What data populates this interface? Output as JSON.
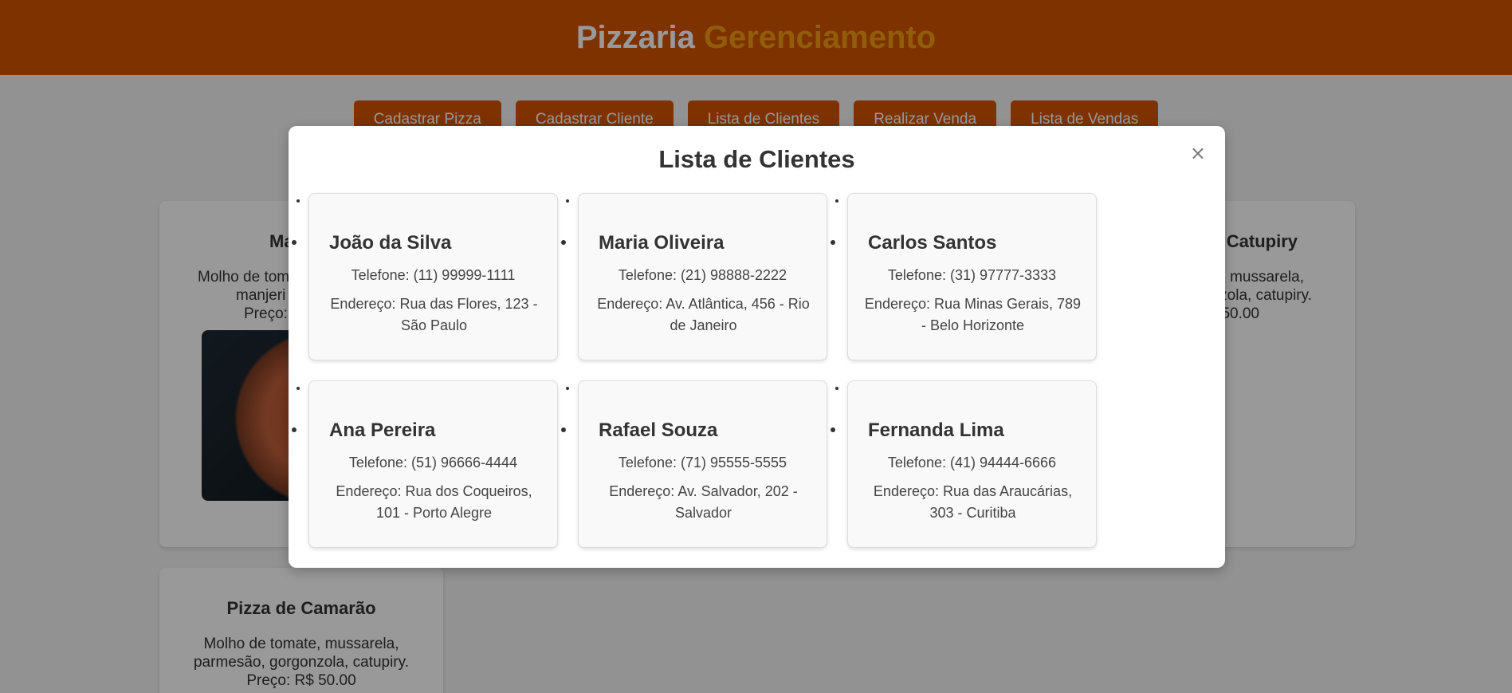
{
  "header": {
    "brand_main": "Pizzaria",
    "brand_accent": "Gerenciamento"
  },
  "nav": {
    "items": [
      {
        "label": "Cadastrar Pizza"
      },
      {
        "label": "Cadastrar Cliente"
      },
      {
        "label": "Lista de Clientes"
      },
      {
        "label": "Realizar Venda"
      },
      {
        "label": "Lista de Vendas"
      }
    ]
  },
  "pizzas": [
    {
      "name": "Mar",
      "desc_line1": "Molho de tom",
      "desc_line2": "manjeri",
      "price": "Preço:"
    },
    {
      "name": "Catupiry",
      "desc_line1": "e, mussarela,",
      "desc_line2": "nzola, catupiry.",
      "price": "50.00"
    },
    {
      "name": "Pizza de Camarão",
      "desc_line1": "Molho de tomate, mussarela,",
      "desc_line2": "parmesão, gorgonzola, catupiry.",
      "price": "Preço: R$ 50.00"
    }
  ],
  "modal": {
    "title": "Lista de Clientes",
    "close_label": "×",
    "clients": [
      {
        "name": "João da Silva",
        "phone": "Telefone: (11) 99999-1111",
        "address": "Endereço: Rua das Flores, 123 - São Paulo"
      },
      {
        "name": "Maria Oliveira",
        "phone": "Telefone: (21) 98888-2222",
        "address": "Endereço: Av. Atlântica, 456 - Rio de Janeiro"
      },
      {
        "name": "Carlos Santos",
        "phone": "Telefone: (31) 97777-3333",
        "address": "Endereço: Rua Minas Gerais, 789 - Belo Horizonte"
      },
      {
        "name": "Ana Pereira",
        "phone": "Telefone: (51) 96666-4444",
        "address": "Endereço: Rua dos Coqueiros, 101 - Porto Alegre"
      },
      {
        "name": "Rafael Souza",
        "phone": "Telefone: (71) 95555-5555",
        "address": "Endereço: Av. Salvador, 202 - Salvador"
      },
      {
        "name": "Fernanda Lima",
        "phone": "Telefone: (41) 94444-6666",
        "address": "Endereço: Rua das Araucárias, 303 - Curitiba"
      }
    ]
  },
  "colors": {
    "header_bg": "#d35400",
    "brand_accent": "#f39c12",
    "button_bg": "#d35400",
    "overlay": "rgba(0,0,0,0.4)"
  }
}
